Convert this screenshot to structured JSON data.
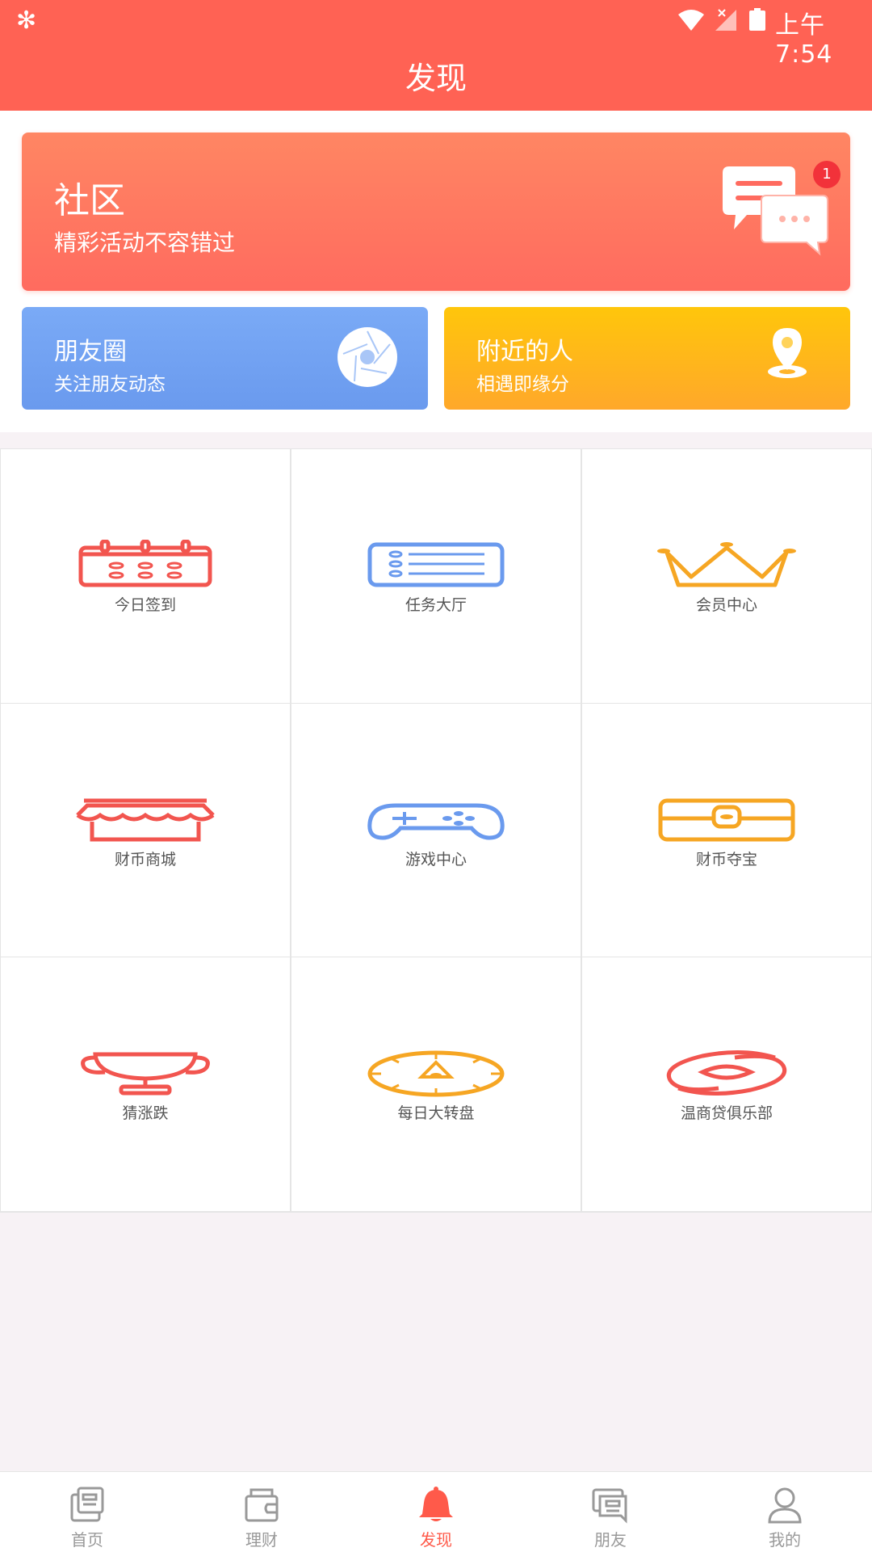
{
  "status_bar": {
    "time": "上午7:54"
  },
  "header": {
    "title": "发现"
  },
  "community": {
    "title": "社区",
    "subtitle": "精彩活动不容错过",
    "badge": "1"
  },
  "moments": {
    "title": "朋友圈",
    "subtitle": "关注朋友动态"
  },
  "nearby": {
    "title": "附近的人",
    "subtitle": "相遇即缘分"
  },
  "grid": [
    {
      "label": "今日签到",
      "icon": "calendar-icon",
      "color": "#f2554f"
    },
    {
      "label": "任务大厅",
      "icon": "task-list-icon",
      "color": "#6a9aee"
    },
    {
      "label": "会员中心",
      "icon": "crown-icon",
      "color": "#f6a623"
    },
    {
      "label": "财币商城",
      "icon": "shop-icon",
      "color": "#f2554f"
    },
    {
      "label": "游戏中心",
      "icon": "gamepad-icon",
      "color": "#6a9aee"
    },
    {
      "label": "财币夺宝",
      "icon": "treasure-box-icon",
      "color": "#f6a623"
    },
    {
      "label": "猜涨跌",
      "icon": "trophy-icon",
      "color": "#f2554f"
    },
    {
      "label": "每日大转盘",
      "icon": "wheel-icon",
      "color": "#f6a623"
    },
    {
      "label": "温商贷俱乐部",
      "icon": "club-logo-icon",
      "color": "#f2554f"
    }
  ],
  "bottom_nav": [
    {
      "label": "首页",
      "icon": "home-icon"
    },
    {
      "label": "理财",
      "icon": "wallet-icon"
    },
    {
      "label": "发现",
      "icon": "bell-icon",
      "active": true
    },
    {
      "label": "朋友",
      "icon": "chat-icon"
    },
    {
      "label": "我的",
      "icon": "user-icon"
    }
  ],
  "colors": {
    "header": "#ff6254",
    "active_tab": "#ff5a4a"
  }
}
